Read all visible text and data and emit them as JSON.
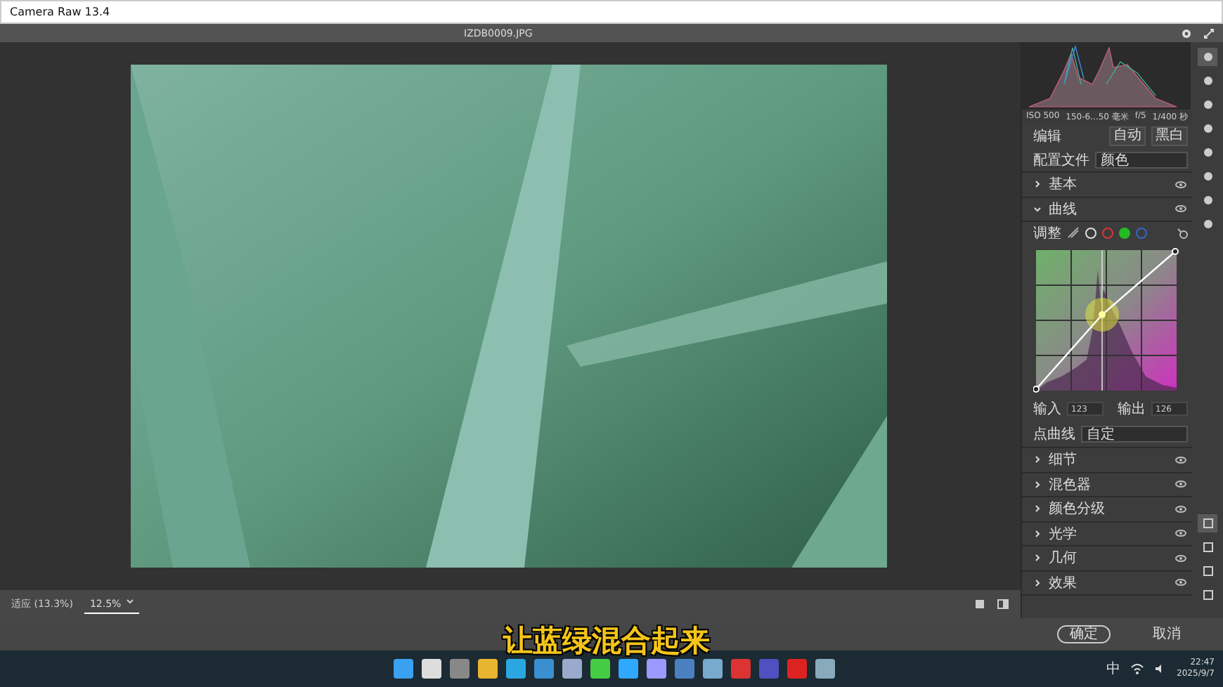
{
  "window": {
    "title": "Camera Raw 13.4"
  },
  "header": {
    "filename": "IZDB0009.JPG"
  },
  "histogram": {
    "info": [
      "ISO 500",
      "150-6...50 毫米",
      "f/5",
      "1/400 秒"
    ]
  },
  "edit": {
    "title": "编辑",
    "buttons": [
      "自动",
      "黑白"
    ],
    "profile": {
      "label": "配置文件",
      "value": "颜色"
    }
  },
  "sections": [
    {
      "title": "基本",
      "expanded": false
    },
    {
      "title": "曲线",
      "expanded": true
    },
    {
      "title": "细节",
      "expanded": false
    },
    {
      "title": "混色器",
      "expanded": false
    },
    {
      "title": "颜色分级",
      "expanded": false
    },
    {
      "title": "光学",
      "expanded": false
    },
    {
      "title": "几何",
      "expanded": false
    },
    {
      "title": "效果",
      "expanded": false
    }
  ],
  "curve": {
    "label": "调整",
    "channels": [
      {
        "kind": "parametric",
        "selected": false
      },
      {
        "kind": "point",
        "selected": false
      },
      {
        "kind": "red",
        "selected": false
      },
      {
        "kind": "green",
        "selected": true
      },
      {
        "kind": "blue",
        "selected": false
      }
    ],
    "input": {
      "label": "输入",
      "value": "123"
    },
    "output": {
      "label": "输出",
      "value": "126"
    },
    "point_curve": {
      "label": "点曲线",
      "value": "自定"
    }
  },
  "zoom": {
    "fit": "适应 (13.3%)",
    "value": "12.5%"
  },
  "buttons": [
    {
      "label": "确定",
      "kind": "primary"
    },
    {
      "label": "取消",
      "kind": "plain"
    }
  ],
  "subtitle": "让蓝绿混合起来",
  "taskbar": {
    "ime": "中",
    "time": "22:47",
    "date": "2025/9/7"
  }
}
